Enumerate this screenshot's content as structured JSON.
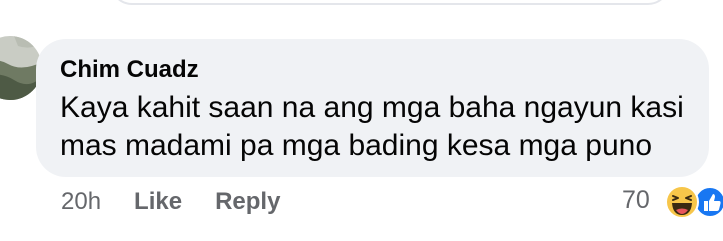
{
  "comment": {
    "author": "Chim Cuadz",
    "text": "Kaya kahit saan na ang mga baha ngayun kasi mas madami pa mga bading kesa mga puno",
    "time": "20h",
    "like_label": "Like",
    "reply_label": "Reply",
    "reaction_count": "70",
    "reactions": [
      "haha-icon",
      "like-icon"
    ]
  },
  "colors": {
    "bubble_bg": "#f0f2f5",
    "meta_text": "#65676b",
    "like_blue": "#1877f2",
    "haha_yellow": "#f7c64a"
  }
}
